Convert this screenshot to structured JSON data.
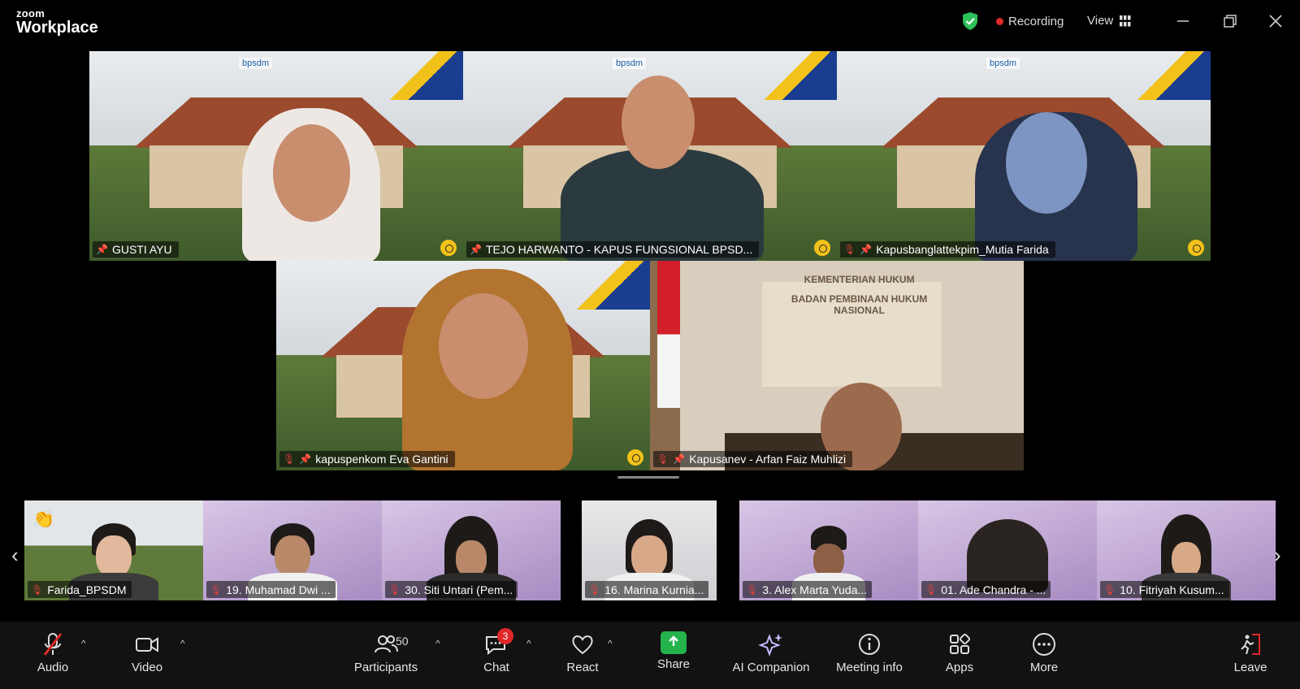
{
  "app": {
    "brand_line1": "zoom",
    "brand_line2": "Workplace"
  },
  "titlebar": {
    "recording_label": "Recording",
    "view_label": "View"
  },
  "main_tiles": [
    {
      "name": "GUSTI AYU",
      "muted": false,
      "speaking": true
    },
    {
      "name": "TEJO HARWANTO - KAPUS FUNGSIONAL BPSD...",
      "muted": false
    },
    {
      "name": "Kapusbanglattekpim_Mutia Farida",
      "muted": true
    },
    {
      "name": "kapuspenkom Eva Gantini",
      "muted": true
    },
    {
      "name": "Kapusanev - Arfan Faiz Muhlizi",
      "muted": true
    }
  ],
  "office_sign": {
    "line1": "KEMENTERIAN HUKUM",
    "line2": "BADAN PEMBINAAN HUKUM NASIONAL"
  },
  "strip": [
    {
      "name": "Farida_BPSDM",
      "reaction": "👏"
    },
    {
      "name": "19. Muhamad Dwi ..."
    },
    {
      "name": "30. Siti Untari (Pem..."
    },
    {
      "name": "16. Marina Kurnia..."
    },
    {
      "name": "3. Alex Marta Yuda..."
    },
    {
      "name": "01. Ade Chandra - ..."
    },
    {
      "name": "10. Fitriyah Kusum..."
    }
  ],
  "toolbar": {
    "audio": "Audio",
    "video": "Video",
    "participants": "Participants",
    "participants_count": "50",
    "chat": "Chat",
    "chat_badge": "3",
    "react": "React",
    "share": "Share",
    "ai_companion": "AI Companion",
    "meeting_info": "Meeting info",
    "apps": "Apps",
    "more": "More",
    "leave": "Leave"
  }
}
